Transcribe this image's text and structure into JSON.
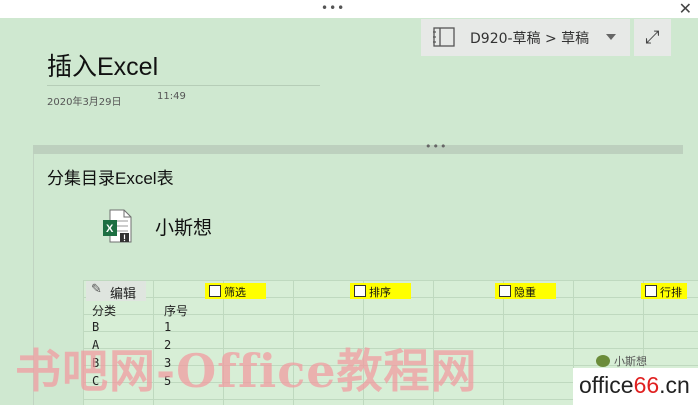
{
  "window": {
    "top_dots": "•••",
    "close_glyph": "✕"
  },
  "header": {
    "notebook_location": "D920-草稿 > 草稿",
    "expand_glyph": "⤢",
    "icons": {
      "notebook": "notebook-icon",
      "caret": "chevron-down-icon",
      "expand": "expand-icon"
    }
  },
  "page": {
    "title": "插入Excel",
    "date": "2020年3月29日",
    "time": "11:49"
  },
  "container": {
    "grip": "•••"
  },
  "content": {
    "section_heading": "分集目录Excel表",
    "attachment": {
      "file_name": "小斯想",
      "icon": "excel-file-icon"
    }
  },
  "spreadsheet": {
    "edit_label": "编辑",
    "controls": [
      "筛选",
      "排序",
      "隐重",
      "行排"
    ],
    "headers": [
      "分类",
      "序号"
    ],
    "rows": [
      [
        "B",
        "1"
      ],
      [
        "A",
        "2"
      ],
      [
        "B",
        "3"
      ],
      [
        "C",
        "5"
      ]
    ],
    "bird_label": "小斯想"
  },
  "watermark": "书吧网-Office教程网",
  "badge": {
    "text_a": "office",
    "text_b": "66",
    "text_c": ".cn"
  },
  "colors": {
    "background": "#cfe8d0",
    "highlight": "#ffff00",
    "watermark": "#f29aa0"
  }
}
